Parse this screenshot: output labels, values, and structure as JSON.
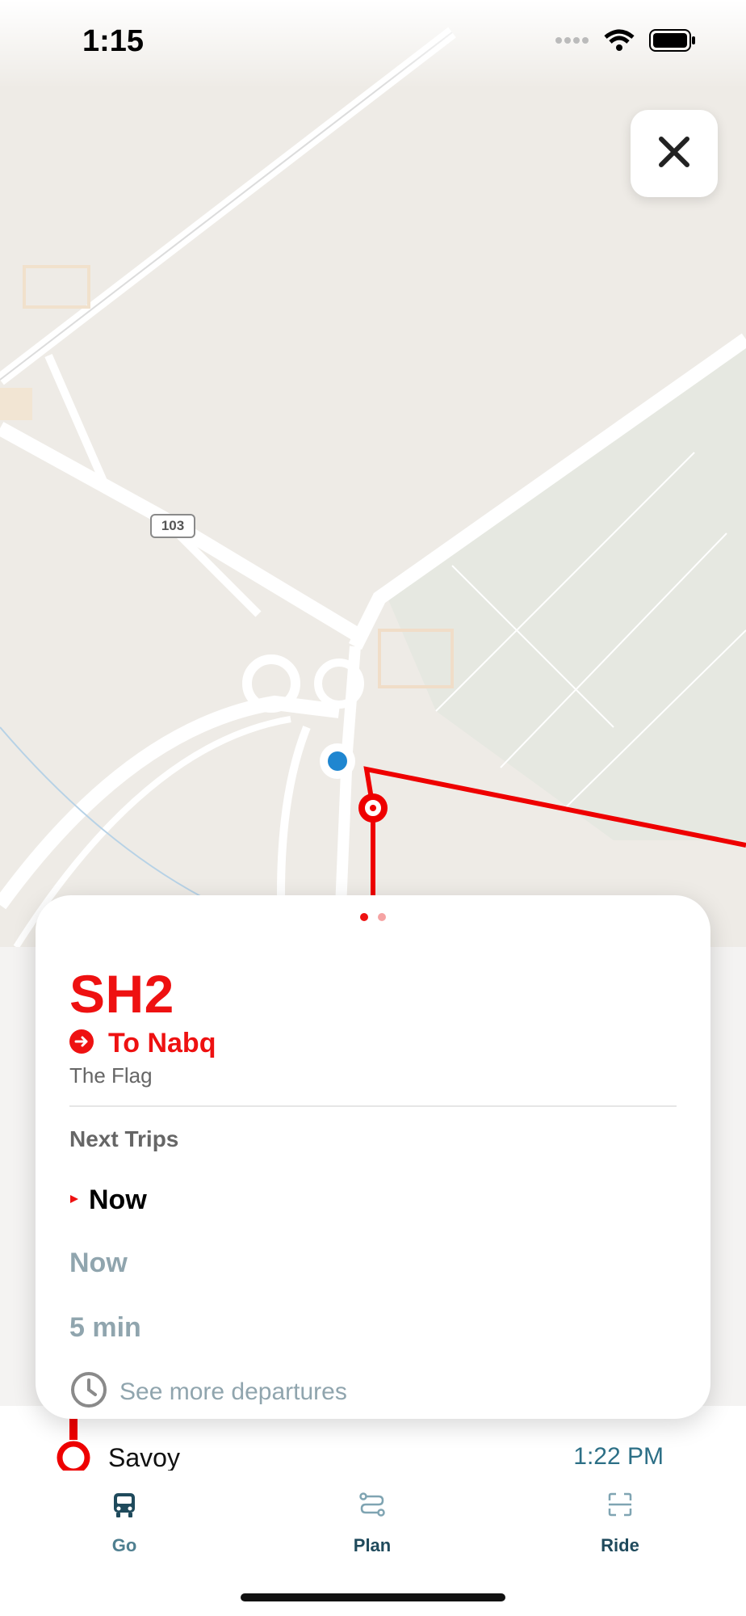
{
  "status_bar": {
    "time": "1:15"
  },
  "map": {
    "road_shield": "103"
  },
  "close_button": {
    "icon": "close-icon"
  },
  "card": {
    "route_code": "SH2",
    "destination": "To Nabq",
    "stop_name": "The Flag",
    "next_trips_title": "Next Trips",
    "trips": [
      "Now",
      "Now",
      "5 min"
    ],
    "see_more": "See more departures",
    "accent_color": "#ee1111"
  },
  "stop_list": {
    "stop_name": "Savoy",
    "stop_time": "1:22 PM"
  },
  "tabs": [
    {
      "label": "Go",
      "icon": "bus-icon",
      "active": true
    },
    {
      "label": "Plan",
      "icon": "route-icon",
      "active": false
    },
    {
      "label": "Ride",
      "icon": "scan-icon",
      "active": false
    }
  ]
}
